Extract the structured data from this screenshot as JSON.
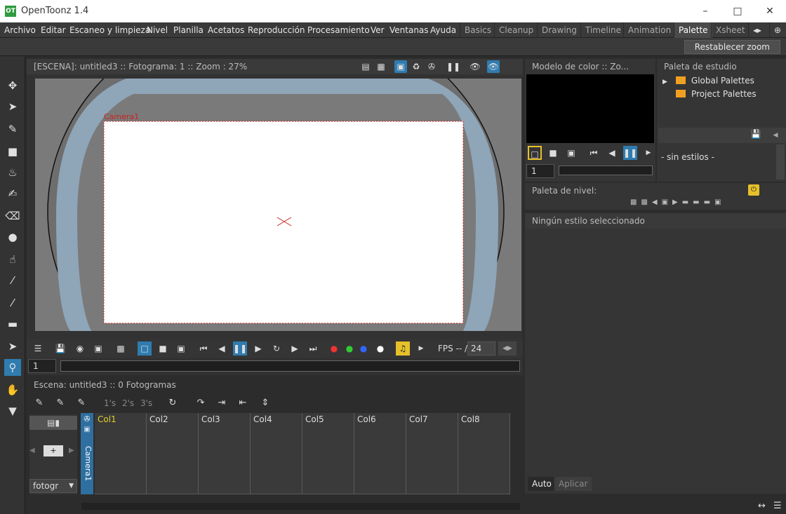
{
  "window": {
    "title": "OpenToonz 1.4",
    "icon_text": "OT"
  },
  "menu": {
    "items": [
      "Archivo",
      "Editar",
      "Escaneo y limpieza",
      "Nivel",
      "Planilla",
      "Acetatos",
      "Reproducción",
      "Procesamiento",
      "Ver",
      "Ventanas",
      "Ayuda"
    ],
    "rooms": [
      "Basics",
      "Cleanup",
      "Drawing",
      "Timeline",
      "Animation",
      "Palette",
      "Xsheet"
    ],
    "active_room": "Palette"
  },
  "toolbar": {
    "reset_zoom_label": "Restablecer zoom"
  },
  "viewer": {
    "header": "[ESCENA]: untitled3  ::  Fotograma: 1  ::  Zoom : 27%",
    "camera_label": "Camera1",
    "fps_label": "FPS -- /",
    "fps_value": "24",
    "frame_value": "1"
  },
  "xsheet": {
    "header": "Escena: untitled3  ::  0 Fotogramas",
    "steps": [
      "1's",
      "2's",
      "3's"
    ],
    "camera_column": "Camera1",
    "columns": [
      "Col1",
      "Col2",
      "Col3",
      "Col4",
      "Col5",
      "Col6",
      "Col7",
      "Col8"
    ],
    "dropdown_value": "fotogr"
  },
  "style_model": {
    "header": "Modelo de color  ::  Zo...",
    "frame_value": "1"
  },
  "studio_palette": {
    "header": "Paleta de estudio",
    "tree": [
      "Global Palettes",
      "Project Palettes"
    ],
    "no_styles": "- sin estilos -"
  },
  "level_palette": {
    "header": "Paleta de nivel:"
  },
  "style_editor": {
    "header": "Ningún estilo seleccionado",
    "auto_label": "Auto",
    "apply_label": "Aplicar"
  },
  "colors": {
    "accent": "#2f7cb0",
    "camera_safe": "#8fa5b8",
    "camera_frame": "#cc2222"
  }
}
